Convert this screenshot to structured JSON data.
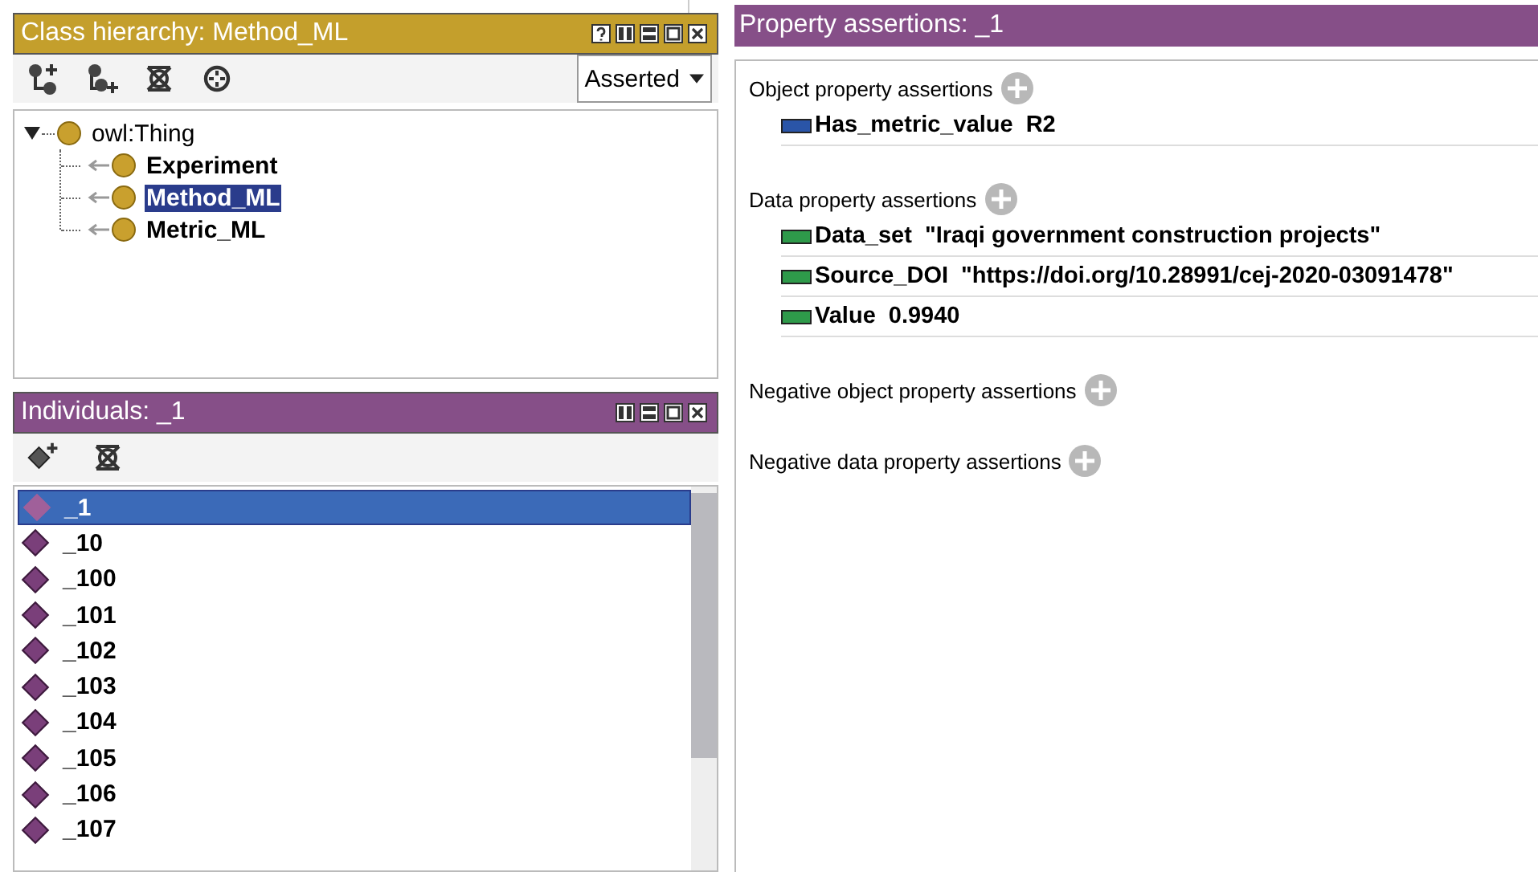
{
  "class_hierarchy": {
    "title": "Class hierarchy: Method_ML",
    "controls": [
      {
        "kind": "help"
      },
      {
        "kind": "split"
      },
      {
        "kind": "minimize"
      },
      {
        "kind": "maximize"
      },
      {
        "kind": "close"
      }
    ],
    "toolbar": [
      {
        "kind": "add-subclass"
      },
      {
        "kind": "add-sibling"
      },
      {
        "kind": "delete"
      },
      {
        "kind": "target"
      }
    ],
    "view": "Asserted",
    "tree": {
      "label": "owl:Thing",
      "expanded": true,
      "selected": false,
      "children": [
        {
          "label": "Experiment",
          "selected": false
        },
        {
          "label": "Method_ML",
          "selected": true
        },
        {
          "label": "Metric_ML",
          "selected": false
        }
      ]
    }
  },
  "individuals": {
    "title": "Individuals: _1",
    "controls": [
      {
        "kind": "split"
      },
      {
        "kind": "minimize"
      },
      {
        "kind": "maximize"
      },
      {
        "kind": "close"
      }
    ],
    "toolbar": [
      {
        "kind": "add"
      },
      {
        "kind": "delete"
      }
    ],
    "items": [
      {
        "label": "_1",
        "selected": true
      },
      {
        "label": "_10",
        "selected": false
      },
      {
        "label": "_100",
        "selected": false
      },
      {
        "label": "_101",
        "selected": false
      },
      {
        "label": "_102",
        "selected": false
      },
      {
        "label": "_103",
        "selected": false
      },
      {
        "label": "_104",
        "selected": false
      },
      {
        "label": "_105",
        "selected": false
      },
      {
        "label": "_106",
        "selected": false
      },
      {
        "label": "_107",
        "selected": false
      }
    ]
  },
  "property_assertions": {
    "title": "Property assertions: _1",
    "sections": [
      {
        "title": "Object property assertions",
        "items": [
          {
            "kind": "object",
            "property": "Has_metric_value",
            "value": "R2"
          }
        ]
      },
      {
        "title": "Data property assertions",
        "items": [
          {
            "kind": "data",
            "property": "Data_set",
            "value": "\"Iraqi government construction projects\""
          },
          {
            "kind": "data",
            "property": "Source_DOI",
            "value": "\"https://doi.org/10.28991/cej-2020-03091478\""
          },
          {
            "kind": "data",
            "property": "Value",
            "value": "0.9940"
          }
        ]
      },
      {
        "title": "Negative object property assertions"
      },
      {
        "title": "Negative data property assertions"
      }
    ]
  }
}
